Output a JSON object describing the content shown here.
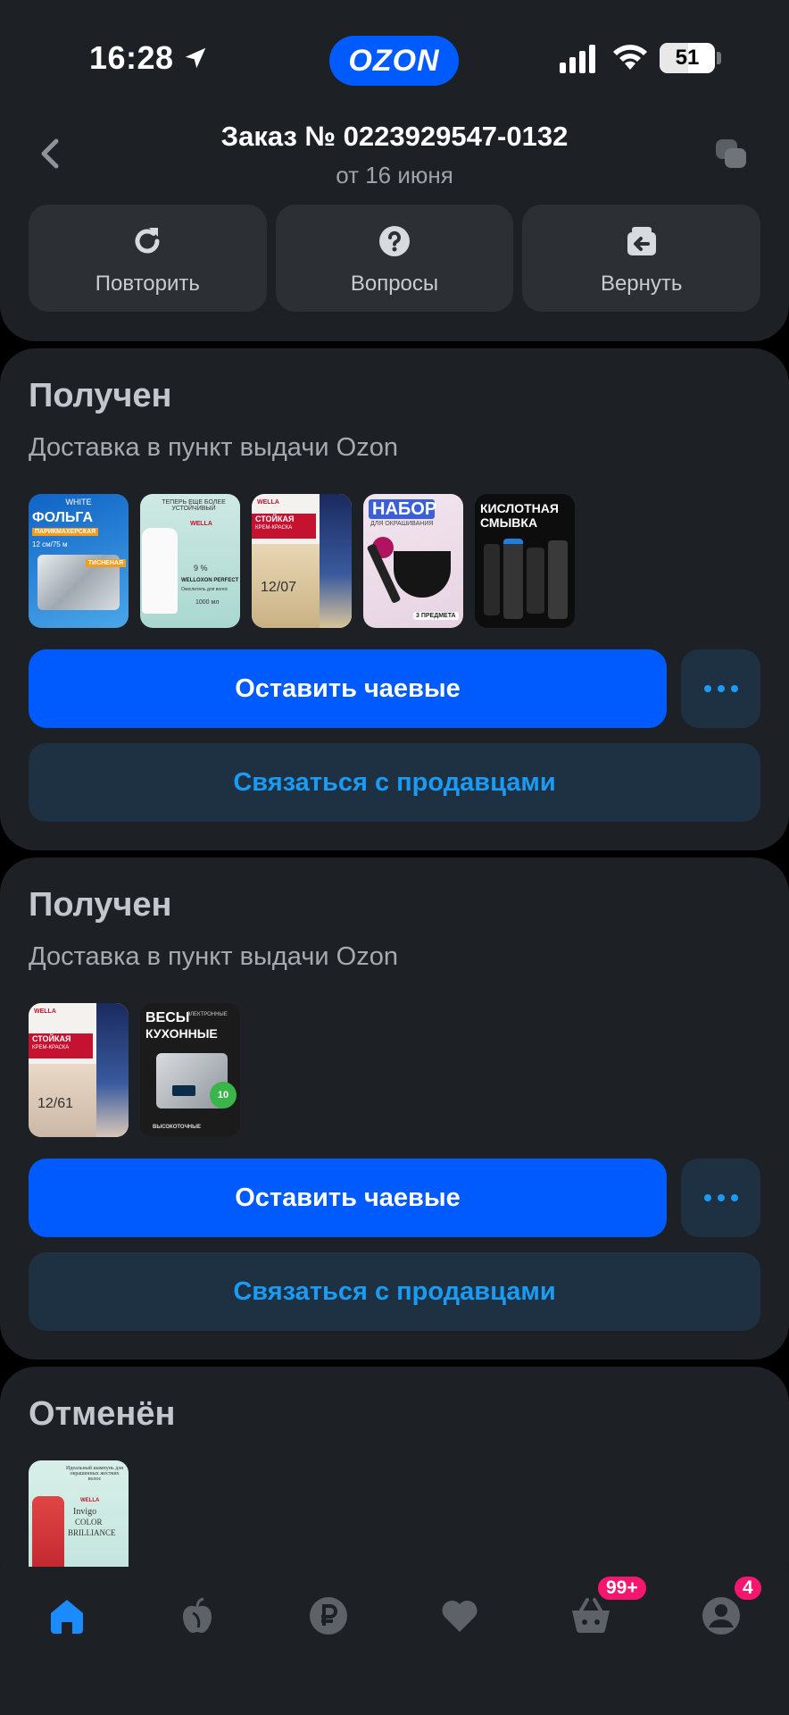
{
  "status_bar": {
    "time": "16:28",
    "brand": "OZON",
    "battery": 51,
    "battery_label": "51"
  },
  "header": {
    "title": "Заказ № 0223929547-0132",
    "subtitle": "от 16 июня",
    "actions": [
      {
        "label": "Повторить",
        "icon": "repeat-icon"
      },
      {
        "label": "Вопросы",
        "icon": "question-icon"
      },
      {
        "label": "Вернуть",
        "icon": "return-box-icon"
      }
    ]
  },
  "shipments": [
    {
      "status": "Получен",
      "delivery": "Доставка в пункт выдачи Ozon",
      "products": [
        {
          "name": "foil-product",
          "text": [
            "WHITE",
            "ФОЛЬГА",
            "ПАРИКМАХЕРСКАЯ",
            "12 см/75 м",
            "ТИСНЕНАЯ"
          ]
        },
        {
          "name": "oxidizer-product",
          "text": [
            "ТЕПЕРЬ ЕЩЕ БОЛЕЕ УСТОЙЧИВЫЙ",
            "WELLA",
            "9 %",
            "WELLOXON PERFECT",
            "Окислитель для волос",
            "1000 мл"
          ]
        },
        {
          "name": "hair-dye-product",
          "text": [
            "WELLA",
            "СТОЙКАЯ",
            "КРЕМ-КРАСКА",
            "12/07"
          ]
        },
        {
          "name": "dye-kit-product",
          "text": [
            "НАБОР",
            "ДЛЯ ОКРАШИВАНИЯ",
            "3 ПРЕДМЕТА"
          ]
        },
        {
          "name": "acid-wash-product",
          "text": [
            "КИСЛОТНАЯ",
            "СМЫВКА"
          ]
        }
      ],
      "tip_label": "Оставить чаевые",
      "contact_label": "Связаться с продавцами"
    },
    {
      "status": "Получен",
      "delivery": "Доставка в пункт выдачи Ozon",
      "products": [
        {
          "name": "hair-dye-product",
          "text": [
            "WELLA",
            "СТОЙКАЯ",
            "КРЕМ-КРАСКА",
            "12/61"
          ]
        },
        {
          "name": "kitchen-scale-product",
          "text": [
            "ВЕСЫ",
            "ЭЛЕКТРОННЫЕ",
            "КУХОННЫЕ",
            "10",
            "ВЫСОКОТОЧНЫЕ"
          ]
        }
      ],
      "tip_label": "Оставить чаевые",
      "contact_label": "Связаться с продавцами"
    },
    {
      "status": "Отменён",
      "products": [
        {
          "name": "shampoo-product",
          "text": [
            "Идеальный шампунь для окрашенных жестких волос",
            "WELLA",
            "Invigo",
            "COLOR",
            "BRILLIANCE"
          ]
        }
      ]
    }
  ],
  "bottom_nav": {
    "items": [
      {
        "name": "home",
        "icon": "home-icon",
        "active": true
      },
      {
        "name": "fresh",
        "icon": "apple-icon"
      },
      {
        "name": "finance",
        "icon": "ruble-icon"
      },
      {
        "name": "favorites",
        "icon": "heart-icon"
      },
      {
        "name": "cart",
        "icon": "basket-icon",
        "badge": "99+"
      },
      {
        "name": "profile",
        "icon": "profile-icon",
        "badge": "4"
      }
    ]
  },
  "colors": {
    "accent": "#005bff",
    "link": "#1a9bf5",
    "badge": "#f5166f",
    "card": "#1d2025"
  }
}
